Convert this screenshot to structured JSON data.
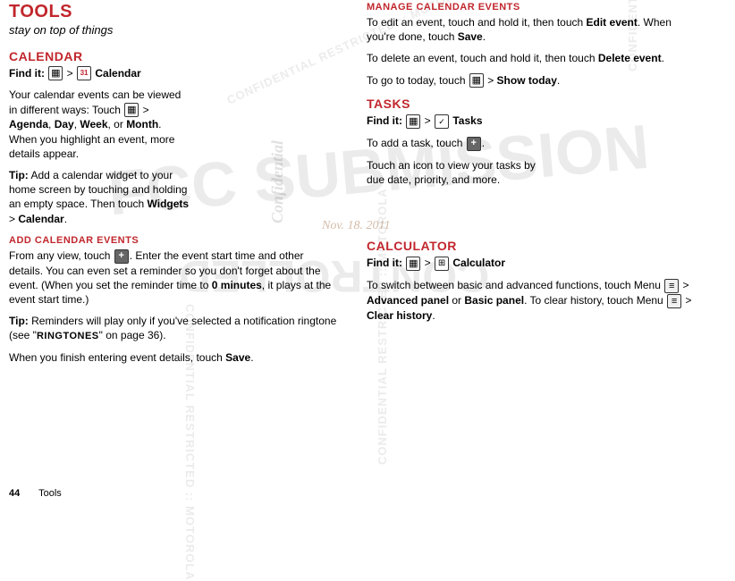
{
  "title": "TOOLS",
  "subtitle": "stay on top of things",
  "date_stamp": "Nov. 18. 2011",
  "watermarks": {
    "big1": "FCC SUBMISSION",
    "restricted": "CONFIDENTIAL RESTRICTED :: MOTOROLA",
    "controlled": "CONTROLLED",
    "fc": "FC"
  },
  "footer": {
    "page": "44",
    "section": "Tools"
  },
  "left": {
    "calendar": {
      "heading": "CALENDAR",
      "find_label": "Find it:",
      "find_path_sep": " > ",
      "find_target": "Calendar",
      "cal31": "31",
      "p1a": "Your calendar events can be viewed in different ways: Touch ",
      "p1b": " > ",
      "p1_agenda": "Agenda",
      "p1_comma": ", ",
      "p1_day": "Day",
      "p1_comma2": ", ",
      "p1_week": "Week",
      "p1_or": ", or ",
      "p1_month": "Month",
      "p1_tail": ". When you highlight an event, more details appear.",
      "tip_label": "Tip:",
      "tip_body": " Add a calendar widget to your home screen by touching and holding an empty space. Then touch ",
      "tip_widgets": "Widgets",
      "tip_gt": " > ",
      "tip_cal": "Calendar",
      "tip_period": ".",
      "add_heading": "ADD CALENDAR EVENTS",
      "add_p1a": "From any view, touch ",
      "add_p1b": ". Enter the event start time and other details. You can even set a reminder so you don't forget about the event. (When you set the reminder time to ",
      "add_0min": "0 minutes",
      "add_p1c": ", it plays at the event start time.)",
      "add_tip_body": " Reminders will play only if you've selected a notification ringtone (see \"",
      "add_ringtones": "RINGTONES",
      "add_tip_tail": "\" on page 36).",
      "add_finish_a": "When you finish entering event details, touch ",
      "add_save": "Save",
      "add_finish_b": "."
    }
  },
  "right": {
    "manage": {
      "heading": "MANAGE CALENDAR EVENTS",
      "p1a": "To edit an event, touch and hold it, then touch ",
      "p1_edit": "Edit event",
      "p1b": ". When you're done, touch ",
      "p1_save": "Save",
      "p1c": ".",
      "p2a": "To delete an event, touch and hold it, then touch ",
      "p2_del": "Delete event",
      "p2b": ".",
      "p3a": "To go to today, touch ",
      "p3b": " > ",
      "p3_show": "Show today",
      "p3c": "."
    },
    "tasks": {
      "heading": "TASKS",
      "find_label": "Find it:",
      "find_sep": " > ",
      "find_target": "Tasks",
      "p1a": "To add a task, touch ",
      "p1b": ".",
      "p2": "Touch an icon to view your tasks by due date, priority, and more."
    },
    "calc": {
      "heading": "CALCULATOR",
      "find_label": "Find it:",
      "find_sep": " > ",
      "find_target": "Calculator",
      "p1a": "To switch between basic and advanced functions, touch Menu ",
      "p1b": " > ",
      "p1_adv": "Advanced panel",
      "p1_or": " or ",
      "p1_basic": "Basic panel",
      "p1c": ". To clear history, touch Menu ",
      "p1d": " > ",
      "p1_clear": "Clear history",
      "p1e": "."
    }
  }
}
